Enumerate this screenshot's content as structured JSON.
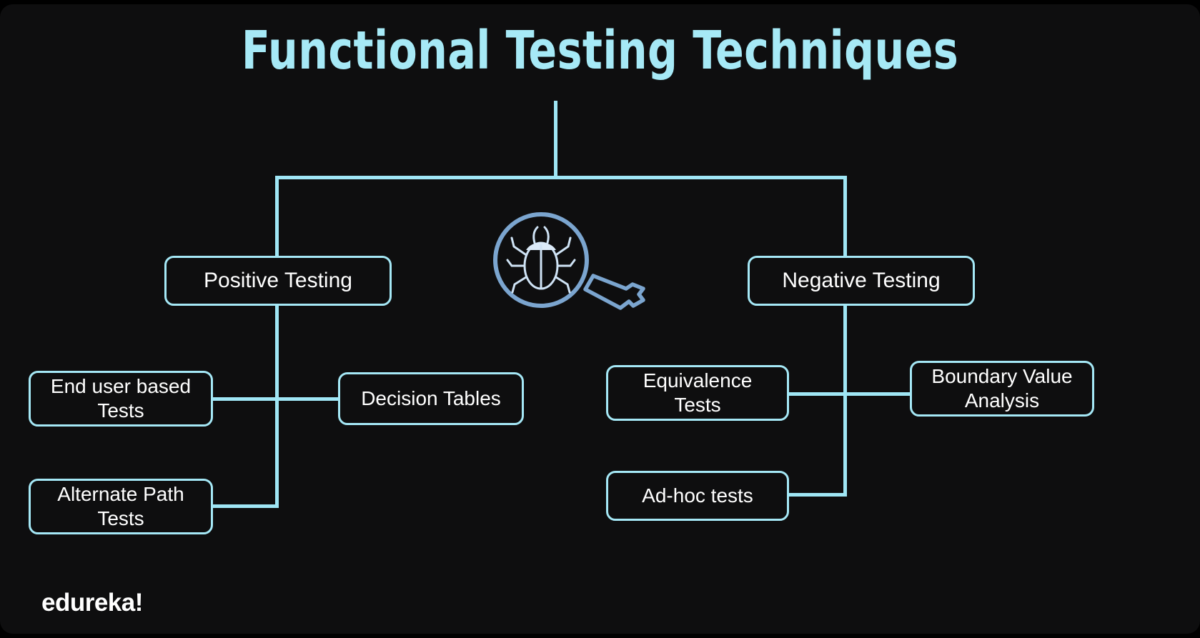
{
  "diagram": {
    "title": "Functional Testing Techniques",
    "background_color": "#0e0e0f",
    "accent_color": "#a5e8f6",
    "title_color": "#a6e9f6",
    "text_color": "#ffffff",
    "icon_color": "#7ba5cf"
  },
  "center_icon": {
    "name": "bug-magnifier-icon",
    "label": "bug under magnifying glass"
  },
  "nodes": {
    "positive": {
      "label": "Positive Testing"
    },
    "negative": {
      "label": "Negative Testing"
    },
    "end_user": {
      "line1": "End user based",
      "line2": "Tests",
      "label": "End user based Tests"
    },
    "decision_tables": {
      "label": "Decision Tables"
    },
    "alternate_path": {
      "line1": "Alternate Path",
      "line2": "Tests",
      "label": "Alternate Path Tests"
    },
    "equivalence": {
      "line1": "Equivalence",
      "line2": "Tests",
      "label": "Equivalence Tests"
    },
    "boundary": {
      "line1": "Boundary Value",
      "line2": "Analysis",
      "label": "Boundary Value Analysis"
    },
    "adhoc": {
      "label": "Ad-hoc tests"
    }
  },
  "logo": {
    "text": "edureka!"
  }
}
